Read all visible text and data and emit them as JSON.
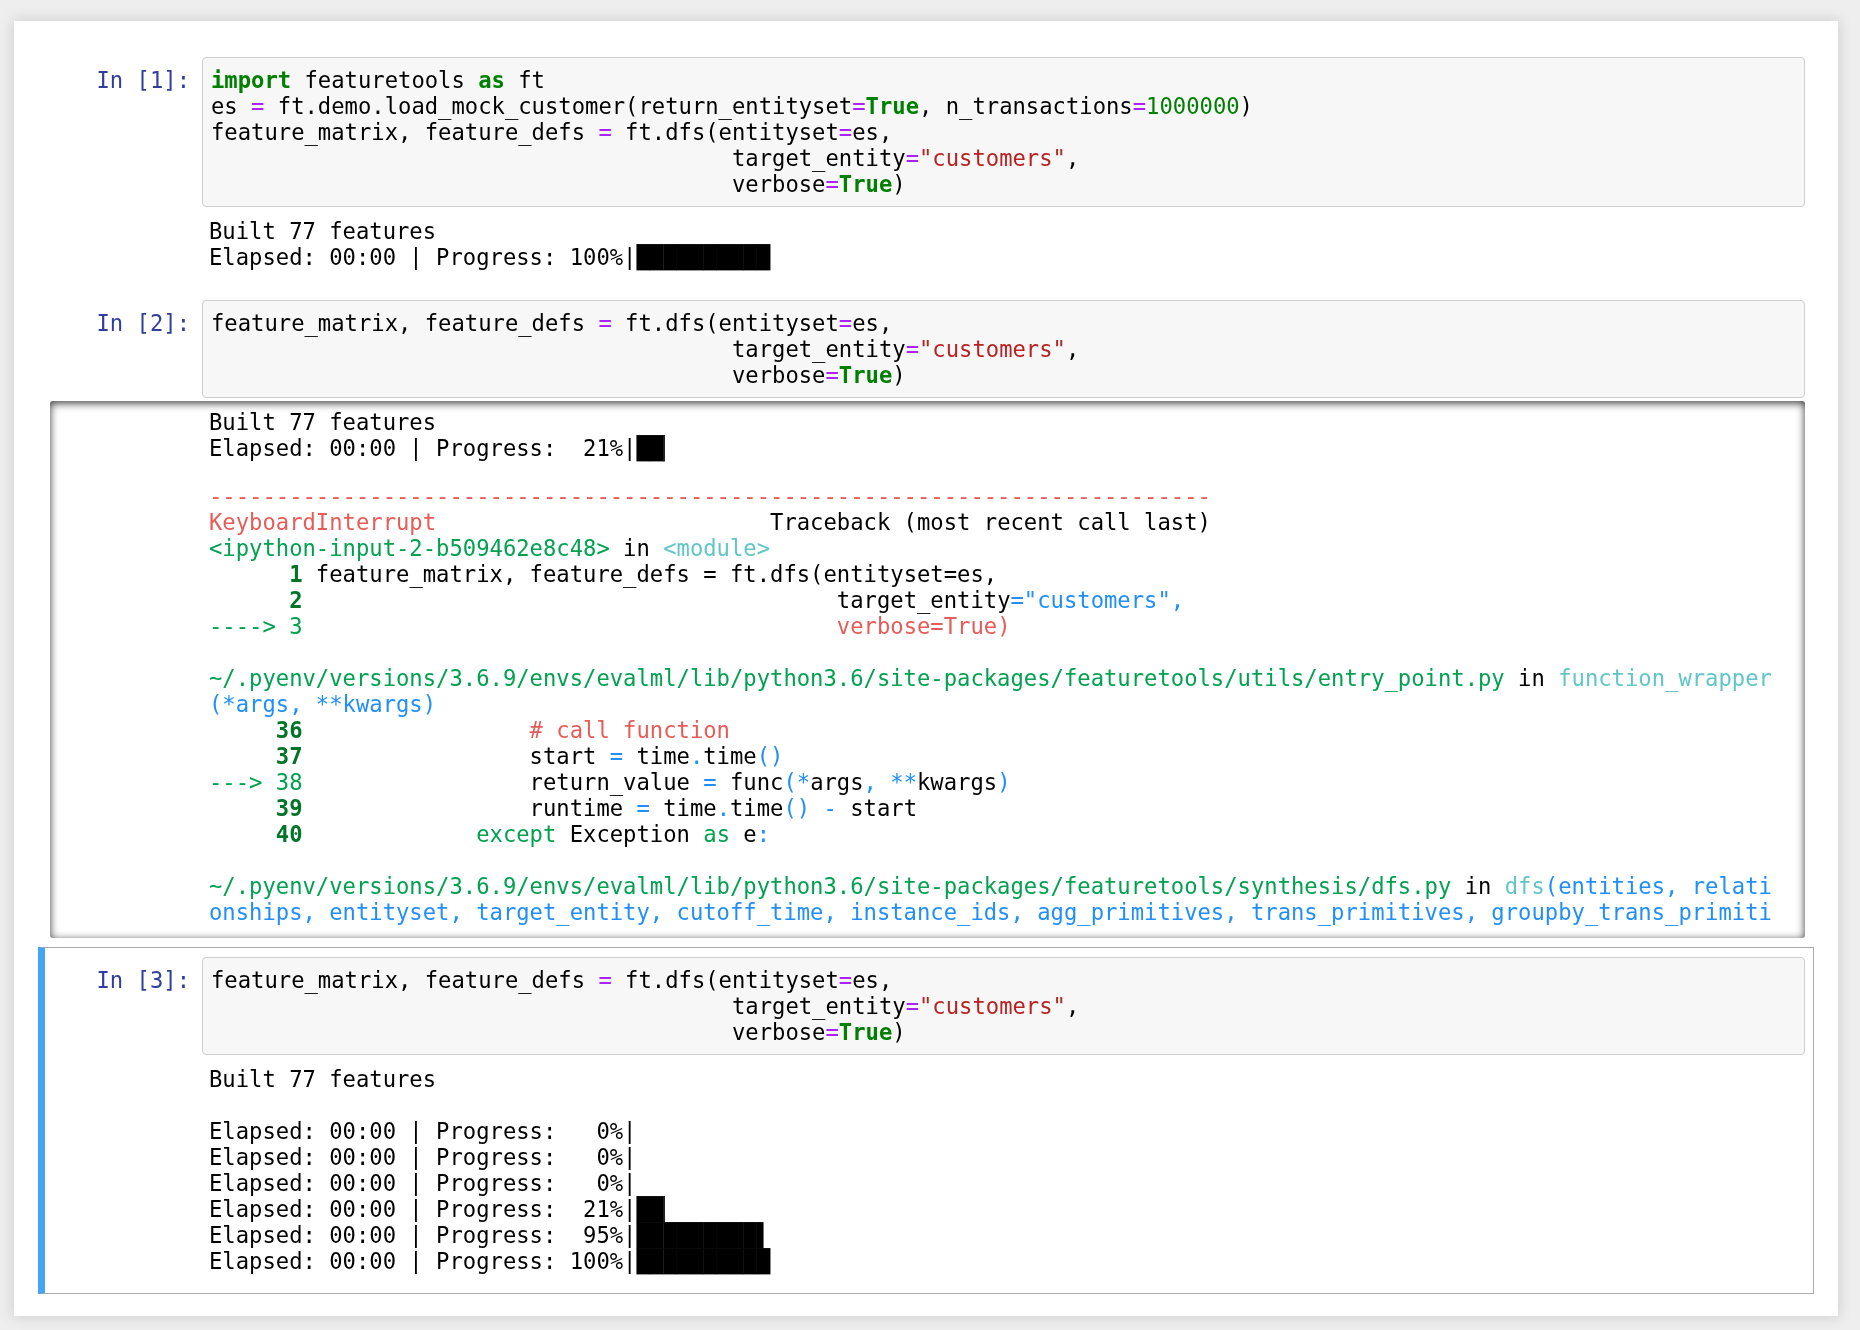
{
  "notebook": {
    "cells": [
      {
        "prompt": "In [1]:",
        "selected": false,
        "input": [
          [
            {
              "kind": "keyword",
              "text": "import"
            },
            {
              "kind": "plain",
              "text": " featuretools "
            },
            {
              "kind": "keyword",
              "text": "as"
            },
            {
              "kind": "plain",
              "text": " ft"
            }
          ],
          [
            {
              "kind": "plain",
              "text": "es "
            },
            {
              "kind": "operator",
              "text": "="
            },
            {
              "kind": "plain",
              "text": " ft.demo.load_mock_customer(return_entityset"
            },
            {
              "kind": "operator",
              "text": "="
            },
            {
              "kind": "keyword",
              "text": "True"
            },
            {
              "kind": "plain",
              "text": ", n_transactions"
            },
            {
              "kind": "operator",
              "text": "="
            },
            {
              "kind": "number",
              "text": "1000000"
            },
            {
              "kind": "plain",
              "text": ")"
            }
          ],
          [
            {
              "kind": "plain",
              "text": "feature_matrix, feature_defs "
            },
            {
              "kind": "operator",
              "text": "="
            },
            {
              "kind": "plain",
              "text": " ft.dfs(entityset"
            },
            {
              "kind": "operator",
              "text": "="
            },
            {
              "kind": "plain",
              "text": "es,"
            }
          ],
          [
            {
              "kind": "plain",
              "text": "                                       target_entity"
            },
            {
              "kind": "operator",
              "text": "="
            },
            {
              "kind": "string",
              "text": "\"customers\""
            },
            {
              "kind": "plain",
              "text": ","
            }
          ],
          [
            {
              "kind": "plain",
              "text": "                                       verbose"
            },
            {
              "kind": "operator",
              "text": "="
            },
            {
              "kind": "keyword",
              "text": "True"
            },
            {
              "kind": "plain",
              "text": ")"
            }
          ]
        ],
        "output": {
          "scrolled": false,
          "items": [
            {
              "kind": "stream",
              "text": "Built 77 features\nElapsed: 00:00 | Progress: 100%|██████████"
            }
          ]
        }
      },
      {
        "prompt": "In [2]:",
        "selected": false,
        "input": [
          [
            {
              "kind": "plain",
              "text": "feature_matrix, feature_defs "
            },
            {
              "kind": "operator",
              "text": "="
            },
            {
              "kind": "plain",
              "text": " ft.dfs(entityset"
            },
            {
              "kind": "operator",
              "text": "="
            },
            {
              "kind": "plain",
              "text": "es,"
            }
          ],
          [
            {
              "kind": "plain",
              "text": "                                       target_entity"
            },
            {
              "kind": "operator",
              "text": "="
            },
            {
              "kind": "string",
              "text": "\"customers\""
            },
            {
              "kind": "plain",
              "text": ","
            }
          ],
          [
            {
              "kind": "plain",
              "text": "                                       verbose"
            },
            {
              "kind": "operator",
              "text": "="
            },
            {
              "kind": "keyword",
              "text": "True"
            },
            {
              "kind": "plain",
              "text": ")"
            }
          ]
        ],
        "output": {
          "scrolled": true,
          "items": [
            {
              "kind": "stream",
              "text": "Built 77 features\nElapsed: 00:00 | Progress:  21%|██▏"
            },
            {
              "kind": "traceback",
              "header": [
                [
                  {
                    "kind": "tb_separator",
                    "text": "---------------------------------------------------------------------------"
                  }
                ],
                [
                  {
                    "kind": "tb_exception",
                    "text": "KeyboardInterrupt"
                  },
                  {
                    "kind": "plain",
                    "text": "                         Traceback (most recent call last)"
                  }
                ]
              ],
              "frames": [
                {
                  "lines": [
                    [
                      {
                        "kind": "tb_file",
                        "text": "<ipython-input-2-b509462e8c48>"
                      },
                      {
                        "kind": "plain",
                        "text": " in "
                      },
                      {
                        "kind": "tb_func",
                        "text": "<module>"
                      }
                    ],
                    [
                      {
                        "kind": "tb_lineno",
                        "text": "      1"
                      },
                      {
                        "kind": "plain",
                        "text": " feature_matrix, feature_defs = ft.dfs(entityset=es,"
                      }
                    ],
                    [
                      {
                        "kind": "tb_lineno",
                        "text": "      2"
                      },
                      {
                        "kind": "plain",
                        "text": "                                        target_entity"
                      },
                      {
                        "kind": "tb_value",
                        "text": "=\"customers\","
                      }
                    ],
                    [
                      {
                        "kind": "tb_arrow",
                        "text": "----> 3"
                      },
                      {
                        "kind": "tb_current",
                        "text": "                                        verbose=True)"
                      }
                    ]
                  ]
                },
                {
                  "lines": [
                    [
                      {
                        "kind": "tb_file",
                        "text": "~/.pyenv/versions/3.6.9/envs/evalml/lib/python3.6/site-packages/featuretools/utils/entry_point.py"
                      },
                      {
                        "kind": "plain",
                        "text": " in "
                      },
                      {
                        "kind": "tb_func",
                        "text": "function_wrapper"
                      },
                      {
                        "kind": "tb_value",
                        "text": "(*args, **kwargs)"
                      }
                    ],
                    [
                      {
                        "kind": "tb_lineno",
                        "text": "     36"
                      },
                      {
                        "kind": "tb_comment",
                        "text": "                 # call function"
                      }
                    ],
                    [
                      {
                        "kind": "tb_lineno",
                        "text": "     37"
                      },
                      {
                        "kind": "plain",
                        "text": "                 start "
                      },
                      {
                        "kind": "tb_value",
                        "text": "="
                      },
                      {
                        "kind": "plain",
                        "text": " time"
                      },
                      {
                        "kind": "tb_value",
                        "text": "."
                      },
                      {
                        "kind": "plain",
                        "text": "time"
                      },
                      {
                        "kind": "tb_value",
                        "text": "()"
                      }
                    ],
                    [
                      {
                        "kind": "tb_arrow",
                        "text": "---> 38"
                      },
                      {
                        "kind": "plain",
                        "text": "                 return_value "
                      },
                      {
                        "kind": "tb_value",
                        "text": "="
                      },
                      {
                        "kind": "plain",
                        "text": " func"
                      },
                      {
                        "kind": "tb_value",
                        "text": "(*"
                      },
                      {
                        "kind": "plain",
                        "text": "args"
                      },
                      {
                        "kind": "tb_value",
                        "text": ", **"
                      },
                      {
                        "kind": "plain",
                        "text": "kwargs"
                      },
                      {
                        "kind": "tb_value",
                        "text": ")"
                      }
                    ],
                    [
                      {
                        "kind": "tb_lineno",
                        "text": "     39"
                      },
                      {
                        "kind": "plain",
                        "text": "                 runtime "
                      },
                      {
                        "kind": "tb_value",
                        "text": "="
                      },
                      {
                        "kind": "plain",
                        "text": " time"
                      },
                      {
                        "kind": "tb_value",
                        "text": "."
                      },
                      {
                        "kind": "plain",
                        "text": "time"
                      },
                      {
                        "kind": "tb_value",
                        "text": "() -"
                      },
                      {
                        "kind": "plain",
                        "text": " start"
                      }
                    ],
                    [
                      {
                        "kind": "tb_lineno",
                        "text": "     40"
                      },
                      {
                        "kind": "tb_keyword",
                        "text": "             except"
                      },
                      {
                        "kind": "plain",
                        "text": " Exception "
                      },
                      {
                        "kind": "tb_keyword",
                        "text": "as"
                      },
                      {
                        "kind": "plain",
                        "text": " e"
                      },
                      {
                        "kind": "tb_value",
                        "text": ":"
                      }
                    ]
                  ]
                },
                {
                  "lines": [
                    [
                      {
                        "kind": "tb_file",
                        "text": "~/.pyenv/versions/3.6.9/envs/evalml/lib/python3.6/site-packages/featuretools/synthesis/dfs.py"
                      },
                      {
                        "kind": "plain",
                        "text": " in "
                      },
                      {
                        "kind": "tb_func",
                        "text": "dfs"
                      },
                      {
                        "kind": "tb_value",
                        "text": "(entities, relationships, entityset, target_entity, cutoff_time, instance_ids, agg_primitives, trans_primitives, groupby_trans_primiti"
                      }
                    ]
                  ]
                }
              ]
            }
          ]
        }
      },
      {
        "prompt": "In [3]:",
        "selected": true,
        "input": [
          [
            {
              "kind": "plain",
              "text": "feature_matrix, feature_defs "
            },
            {
              "kind": "operator",
              "text": "="
            },
            {
              "kind": "plain",
              "text": " ft.dfs(entityset"
            },
            {
              "kind": "operator",
              "text": "="
            },
            {
              "kind": "plain",
              "text": "es,"
            }
          ],
          [
            {
              "kind": "plain",
              "text": "                                       target_entity"
            },
            {
              "kind": "operator",
              "text": "="
            },
            {
              "kind": "string",
              "text": "\"customers\""
            },
            {
              "kind": "plain",
              "text": ","
            }
          ],
          [
            {
              "kind": "plain",
              "text": "                                       verbose"
            },
            {
              "kind": "operator",
              "text": "="
            },
            {
              "kind": "keyword",
              "text": "True"
            },
            {
              "kind": "plain",
              "text": ")"
            }
          ]
        ],
        "output": {
          "scrolled": false,
          "items": [
            {
              "kind": "stream",
              "text": "Built 77 features\n\nElapsed: 00:00 | Progress:   0%|\nElapsed: 00:00 | Progress:   0%|\nElapsed: 00:00 | Progress:   0%|\nElapsed: 00:00 | Progress:  21%|██▏\nElapsed: 00:00 | Progress:  95%|█████████▌\nElapsed: 00:00 | Progress: 100%|██████████"
            }
          ]
        }
      }
    ]
  }
}
